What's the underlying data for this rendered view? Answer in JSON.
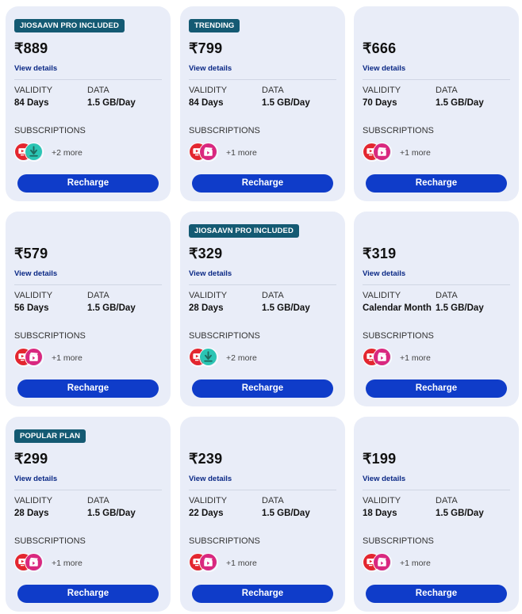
{
  "labels": {
    "view_details": "View details",
    "validity": "VALIDITY",
    "data": "DATA",
    "subscriptions": "SUBSCRIPTIONS",
    "recharge": "Recharge"
  },
  "colors": {
    "card_bg": "#e9edf8",
    "badge_bg": "#145a73",
    "button_bg": "#0f3cc9",
    "link": "#0a2885",
    "jiotv_red": "#e3262f",
    "jiocinema_pink": "#d9287f",
    "jiosaavn_teal": "#2bc5b4"
  },
  "plans": [
    {
      "badge": "JIOSAAVN PRO INCLUDED",
      "price": "₹889",
      "validity": "84 Days",
      "data": "1.5 GB/Day",
      "icons": [
        "jiotv-icon",
        "jiosaavn-icon"
      ],
      "more": "+2 more"
    },
    {
      "badge": "TRENDING",
      "price": "₹799",
      "validity": "84 Days",
      "data": "1.5 GB/Day",
      "icons": [
        "jiotv-icon",
        "jiocinema-icon"
      ],
      "more": "+1 more"
    },
    {
      "badge": "",
      "price": "₹666",
      "validity": "70 Days",
      "data": "1.5 GB/Day",
      "icons": [
        "jiotv-icon",
        "jiocinema-icon"
      ],
      "more": "+1 more"
    },
    {
      "badge": "",
      "price": "₹579",
      "validity": "56 Days",
      "data": "1.5 GB/Day",
      "icons": [
        "jiotv-icon",
        "jiocinema-icon"
      ],
      "more": "+1 more"
    },
    {
      "badge": "JIOSAAVN PRO INCLUDED",
      "price": "₹329",
      "validity": "28 Days",
      "data": "1.5 GB/Day",
      "icons": [
        "jiotv-icon",
        "jiosaavn-icon"
      ],
      "more": "+2 more"
    },
    {
      "badge": "",
      "price": "₹319",
      "validity": "Calendar Month",
      "data": "1.5 GB/Day",
      "icons": [
        "jiotv-icon",
        "jiocinema-icon"
      ],
      "more": "+1 more"
    },
    {
      "badge": "POPULAR PLAN",
      "price": "₹299",
      "validity": "28 Days",
      "data": "1.5 GB/Day",
      "icons": [
        "jiotv-icon",
        "jiocinema-icon"
      ],
      "more": "+1 more"
    },
    {
      "badge": "",
      "price": "₹239",
      "validity": "22 Days",
      "data": "1.5 GB/Day",
      "icons": [
        "jiotv-icon",
        "jiocinema-icon"
      ],
      "more": "+1 more"
    },
    {
      "badge": "",
      "price": "₹199",
      "validity": "18 Days",
      "data": "1.5 GB/Day",
      "icons": [
        "jiotv-icon",
        "jiocinema-icon"
      ],
      "more": "+1 more"
    }
  ]
}
